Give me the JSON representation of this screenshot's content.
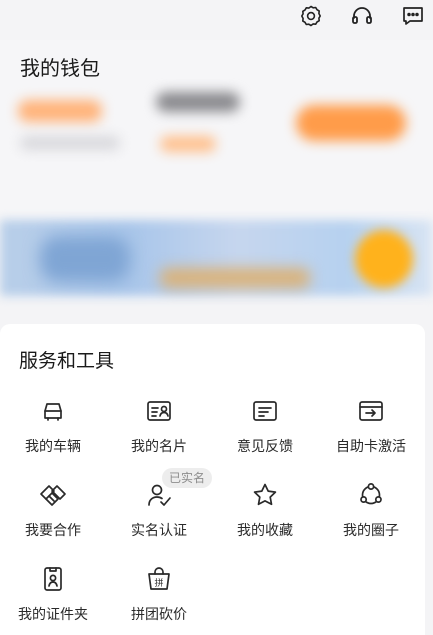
{
  "topbar": {
    "icons": [
      "gear-icon",
      "headset-icon",
      "message-icon"
    ],
    "arrow_color": "#e8202a"
  },
  "wallet": {
    "title": "我的钱包"
  },
  "tools": {
    "title": "服务和工具",
    "items": [
      {
        "label": "我的车辆",
        "icon": "car-icon"
      },
      {
        "label": "我的名片",
        "icon": "id-card-icon"
      },
      {
        "label": "意见反馈",
        "icon": "feedback-icon"
      },
      {
        "label": "自助卡激活",
        "icon": "card-activate-icon"
      },
      {
        "label": "我要合作",
        "icon": "handshake-icon"
      },
      {
        "label": "实名认证",
        "icon": "user-verify-icon",
        "badge": "已实名"
      },
      {
        "label": "我的收藏",
        "icon": "star-icon"
      },
      {
        "label": "我的圈子",
        "icon": "circle-group-icon"
      },
      {
        "label": "我的证件夹",
        "icon": "certificate-icon"
      },
      {
        "label": "拼团砍价",
        "icon": "group-buy-icon"
      }
    ]
  }
}
